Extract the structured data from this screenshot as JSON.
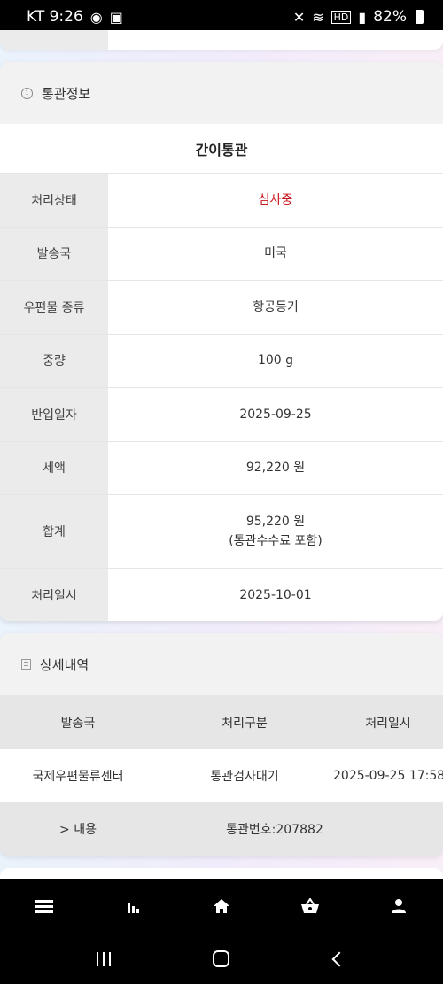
{
  "status_bar": {
    "carrier_time": "KT 9:26",
    "battery": "82%"
  },
  "customs": {
    "header": "통관정보",
    "type": "간이통관",
    "rows": [
      {
        "label": "처리상태",
        "value": "심사중"
      },
      {
        "label": "발송국",
        "value": "미국"
      },
      {
        "label": "우편물 종류",
        "value": "항공등기"
      },
      {
        "label": "중량",
        "value": "100 g"
      },
      {
        "label": "반입일자",
        "value": "2025-09-25"
      },
      {
        "label": "세액",
        "value": "92,220 원"
      },
      {
        "label": "합계",
        "value": "95,220 원",
        "value2": "(통관수수료 포함)"
      },
      {
        "label": "처리일시",
        "value": "2025-10-01"
      }
    ],
    "status_color": "#c8161d"
  },
  "details": {
    "header": "상세내역",
    "columns": [
      "발송국",
      "처리구분",
      "처리일시"
    ],
    "rows": [
      {
        "origin": "국제우편물류센터",
        "type": "통관검사대기",
        "datetime": "2025-09-25 17:58"
      }
    ],
    "footer": {
      "toggle_label": "> 내용",
      "customs_number": "통관번호:207882"
    }
  },
  "nav": {
    "items": [
      "menu-icon",
      "chart-icon",
      "home-icon",
      "basket-icon",
      "person-icon"
    ]
  }
}
